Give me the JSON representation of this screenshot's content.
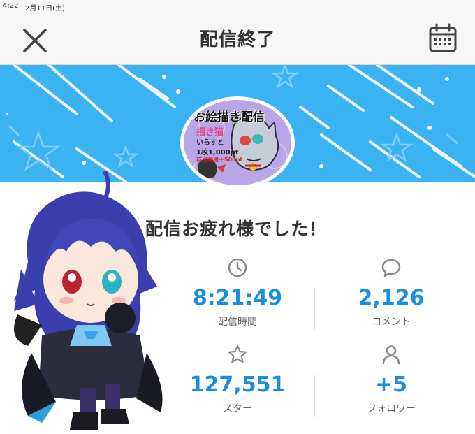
{
  "status_bar": {
    "time": "4:22",
    "date": "2月11日(土)"
  },
  "header": {
    "title": "配信終了"
  },
  "thumbnail": {
    "title": "お絵描き配信",
    "line1": "招き猫",
    "line2": "いらすと",
    "line3": "1枚1,000pt",
    "line4": "商用利用＋500pt"
  },
  "headline": "配信お疲れ様でした！",
  "stats": {
    "duration": {
      "value": "8:21:49",
      "label": "配信時間",
      "icon": "clock-icon"
    },
    "comments": {
      "value": "2,126",
      "label": "コメント",
      "icon": "speech-bubble-icon"
    },
    "stars": {
      "value": "127,551",
      "label": "スター",
      "icon": "star-icon"
    },
    "followers": {
      "value": "+5",
      "label": "フォロワー",
      "icon": "person-icon"
    }
  },
  "colors": {
    "banner": "#3bb3f2",
    "accent": "#1a8ee0",
    "text": "#333333",
    "label": "#666666"
  }
}
